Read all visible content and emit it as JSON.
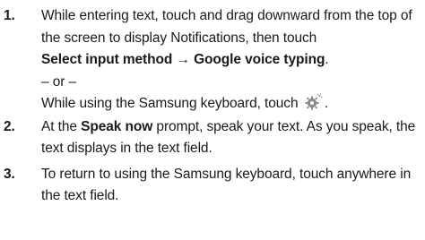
{
  "steps": [
    {
      "number": "1.",
      "line1": "While entering text, touch and drag downward from the top of the screen to display Notifications, then touch",
      "bold_path_1": "Select input method",
      "arrow": "→",
      "bold_path_2": "Google voice typing",
      "period": ".",
      "or_text": "– or –",
      "alt_text": "While using the Samsung keyboard, touch",
      "alt_end": ".",
      "alt_icon": "gear-icon"
    },
    {
      "number": "2.",
      "pre": "At the",
      "bold": "Speak now",
      "post": "prompt, speak your text. As you speak, the text displays in the text field."
    },
    {
      "number": "3.",
      "text": "To return to using the Samsung keyboard, touch anywhere in the text field."
    }
  ],
  "colors": {
    "text": "#1a1a1a",
    "icon_gray": "#8a8a8a"
  }
}
